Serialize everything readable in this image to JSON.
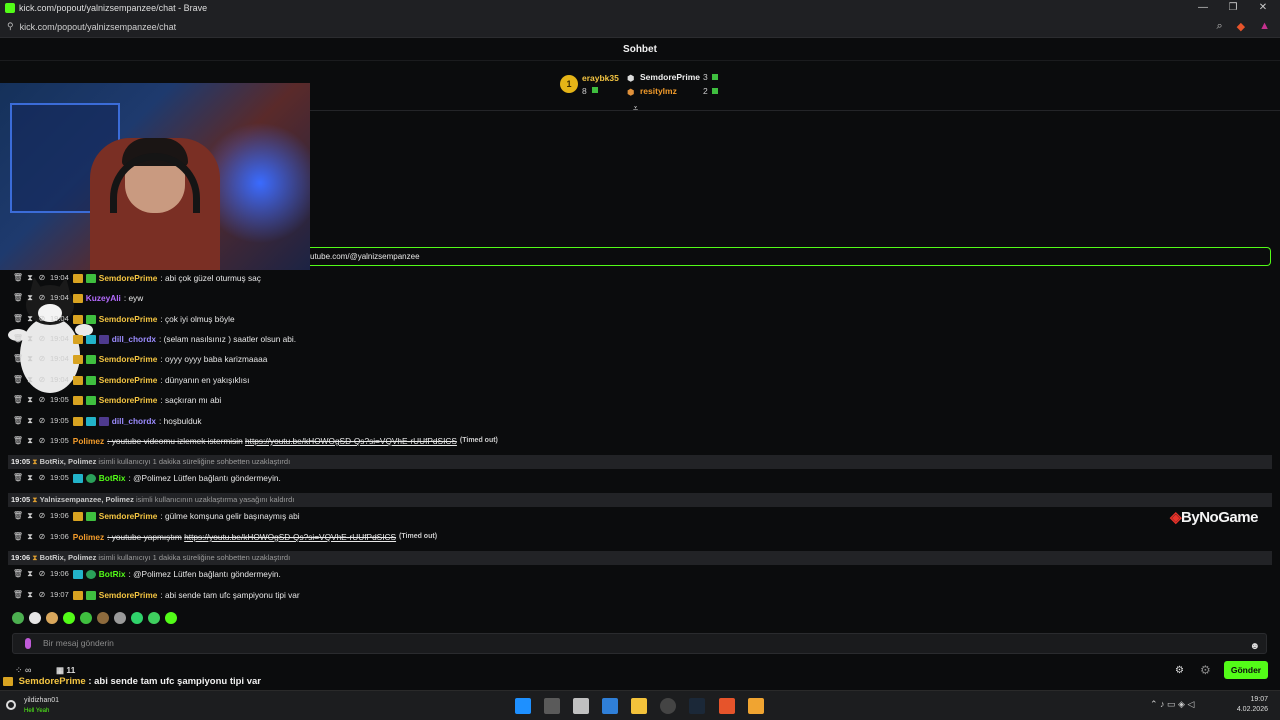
{
  "window": {
    "title": "kick.com/popout/yalnizsempanzee/chat - Brave",
    "url": "kick.com/popout/yalnizsempanzee/chat",
    "min_icon": "minimize-icon",
    "max_icon": "maximize-icon",
    "close_icon": "close-icon"
  },
  "chat": {
    "header": "Sohbet",
    "leaderboard": [
      {
        "rank": "1",
        "name": "eraybk35",
        "count": "8"
      },
      {
        "name": "SemdorePrime",
        "count": "3"
      },
      {
        "name": "resitylmz",
        "count": "2"
      }
    ],
    "pinned_text": "utube.com/@yalnizsempanzee",
    "messages": [
      {
        "time": "19:04",
        "user": "SemdorePrime",
        "text": ": abi çok güzel oturmuş saç"
      },
      {
        "time": "19:04",
        "user": "KuzeyAli",
        "text": ": eyw"
      },
      {
        "time": "19:04",
        "user": "SemdorePrime",
        "text": ": çok iyi olmuş böyle"
      },
      {
        "time": "19:04",
        "user": "dill_chordx",
        "text": ": (selam nasılsınız ) saatler olsun abi."
      },
      {
        "time": "19:04",
        "user": "SemdorePrime",
        "text": ": oyyy oyyy baba karizmaaaa"
      },
      {
        "time": "19:04",
        "user": "SemdorePrime",
        "text": ": dünyanın en yakışıklısı"
      },
      {
        "time": "19:05",
        "user": "SemdorePrime",
        "text": ": saçkıran mı abi"
      },
      {
        "time": "19:05",
        "user": "dill_chordx",
        "text": ": hoşbulduk"
      },
      {
        "time": "19:05",
        "user": "Polimez",
        "text": ": youtube videomu izlemek istermisin",
        "link": "https://youtu.be/kHOWOgSD-Qs?si=VQVhE-rUUfPdSICS",
        "tag": "(Timed out)"
      },
      {
        "time": "19:05",
        "user": "BotRix",
        "text": ": @Polimez Lütfen bağlantı göndermeyin."
      },
      {
        "time": "19:06",
        "user": "SemdorePrime",
        "text": ": gülme komşuna gelir başınaymış abi"
      },
      {
        "time": "19:06",
        "user": "Polimez",
        "text": ": youtube yapmıştım",
        "link": "https://youtu.be/kHOWOgSD-Qs?si=VQVhE-rUUfPdSICS",
        "tag": "(Timed out)"
      },
      {
        "time": "19:06",
        "user": "BotRix",
        "text": ": @Polimez Lütfen bağlantı göndermeyin."
      },
      {
        "time": "19:07",
        "user": "SemdorePrime",
        "text": ": abi sende tam ufc şampiyonu tipi var"
      }
    ],
    "system": [
      {
        "time": "19:05",
        "actors": "BotRix, Polimez",
        "text": "isimli kullanıcıyı 1 dakika süreliğine sohbetten uzaklaştırdı"
      },
      {
        "time": "19:05",
        "actors": "Yalnizsempanzee, Polimez",
        "text": "isimli kullanıcının uzaklaştırma yasağını kaldırdı"
      },
      {
        "time": "19:06",
        "actors": "BotRix, Polimez",
        "text": "isimli kullanıcıyı 1 dakika süreliğine sohbetten uzaklaştırdı"
      }
    ],
    "input_placeholder": "Bir mesaj gönderin",
    "send_label": "Gönder",
    "viewer_count": "11",
    "overlay_caption_user": "SemdorePrime",
    "overlay_caption_text": ": abi sende tam ufc şampiyonu tipi var"
  },
  "brand": {
    "watermark": "ByNoGame",
    "accent": "#53fc18"
  },
  "taskbar": {
    "user_name": "yildizhan01",
    "user_status": "Hell Yeah",
    "time": "19:07",
    "date": "4.02.2026"
  }
}
